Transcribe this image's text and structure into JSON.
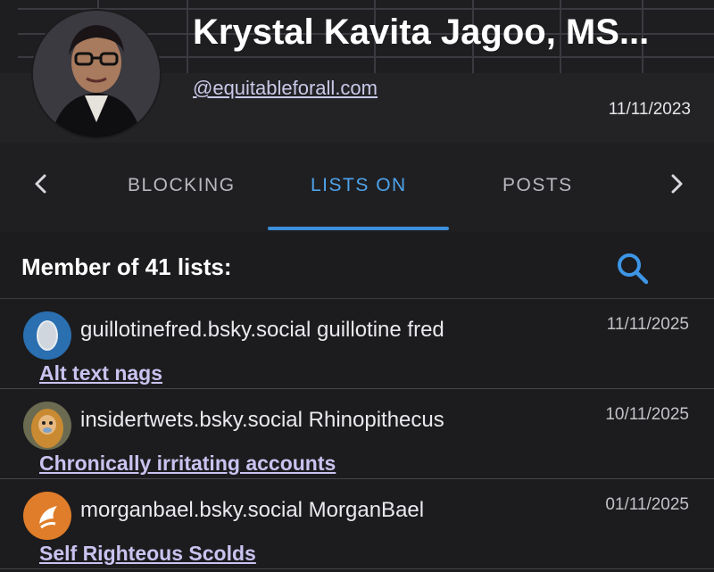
{
  "profile": {
    "display_name": "Krystal Kavita Jagoo, MS...",
    "handle": "@equitableforall.com",
    "joined_date": "11/11/2023"
  },
  "tabs": {
    "items": [
      {
        "label": "BLOCKING",
        "active": false
      },
      {
        "label": "LISTS ON",
        "active": true
      },
      {
        "label": "POSTS",
        "active": false
      }
    ],
    "prev_icon": "chevron-left-icon",
    "next_icon": "chevron-right-icon"
  },
  "section": {
    "title": "Member of 41 lists:",
    "search_icon": "search-icon"
  },
  "lists": [
    {
      "owner": "guillotinefred.bsky.social guillotine fred",
      "date": "11/11/2025",
      "list_name": "Alt text nags",
      "avatar_color": "#2a6fb0"
    },
    {
      "owner": "insidertwets.bsky.social Rhinopithecus",
      "date": "10/11/2025",
      "list_name": "Chronically irritating accounts",
      "avatar_color": "#c98a32"
    },
    {
      "owner": "morganbael.bsky.social MorganBael",
      "date": "01/11/2025",
      "list_name": "Self Righteous Scolds",
      "avatar_color": "#e07d2a"
    }
  ],
  "colors": {
    "accent": "#4ea3ea",
    "link": "#c9c3f0",
    "background": "#1c1c1e"
  }
}
